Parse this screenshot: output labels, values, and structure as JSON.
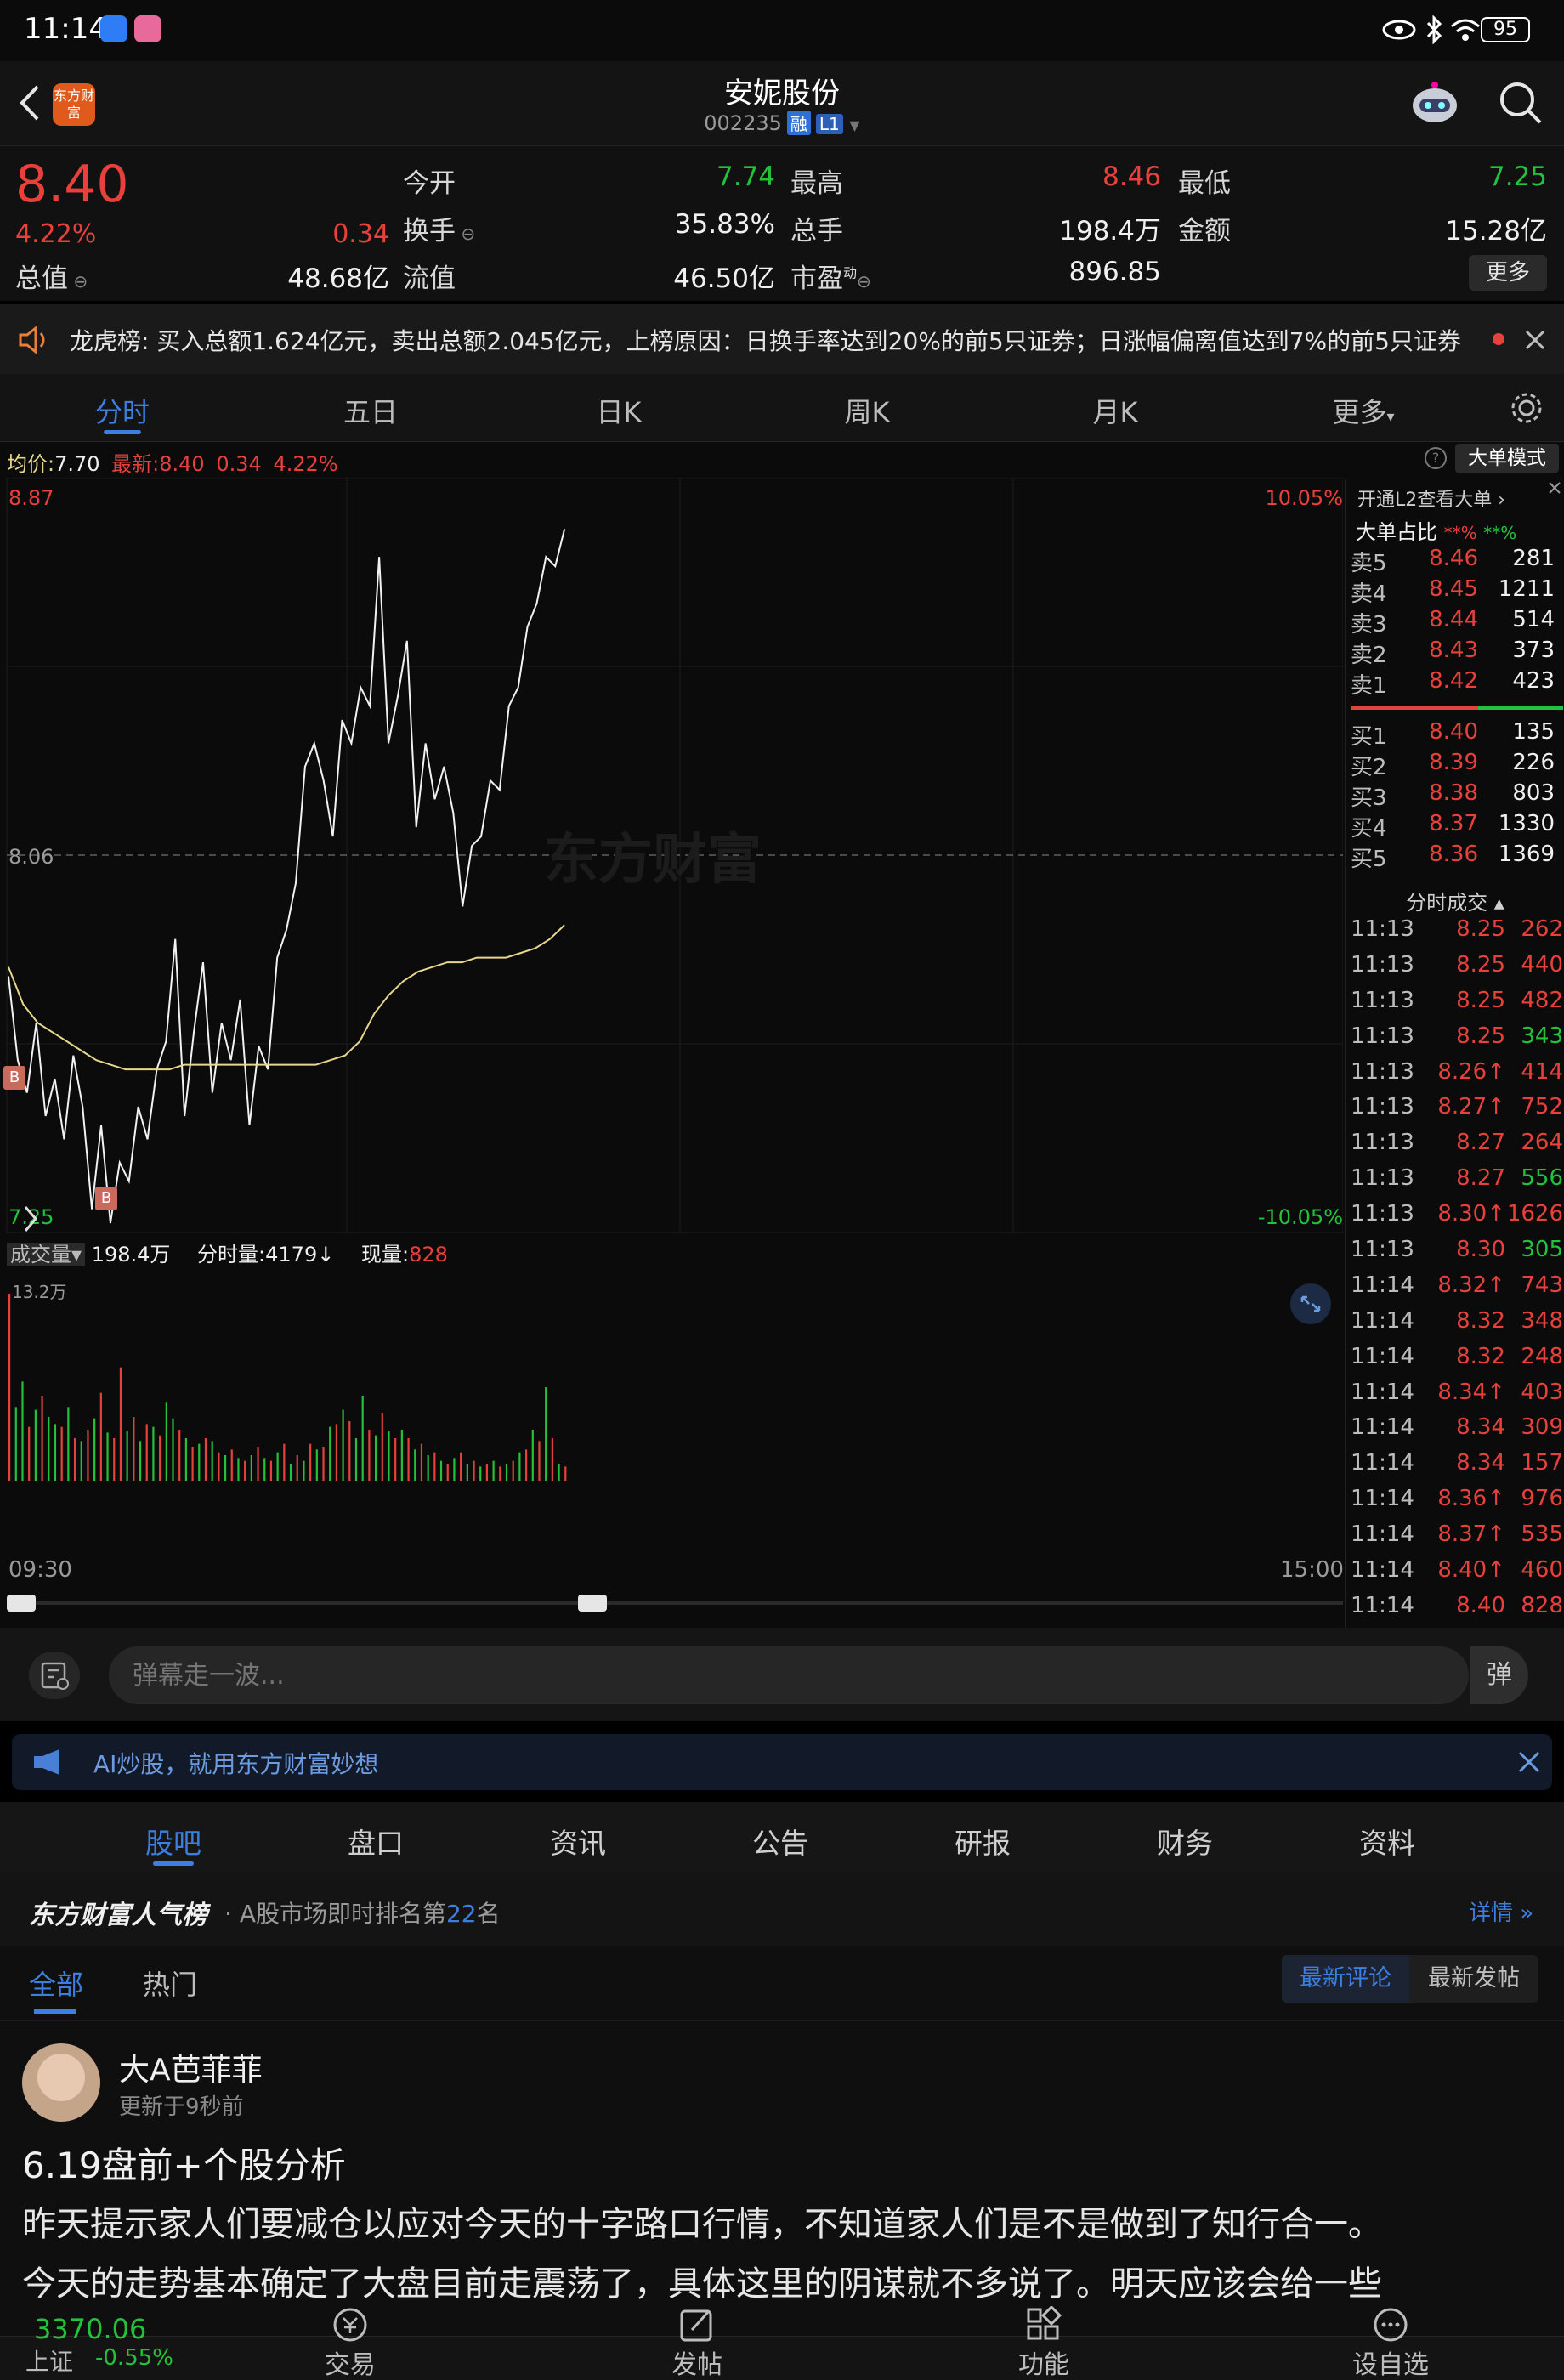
{
  "status_bar": {
    "time": "11:14",
    "battery": "95"
  },
  "header": {
    "logo_text": "东方财富",
    "stock_name": "安妮股份",
    "stock_code": "002235",
    "badge_margin": "融",
    "badge_level": "L1"
  },
  "quote": {
    "price": "8.40",
    "change_pct": "4.22%",
    "change_abs": "0.34",
    "total_value_label": "总值",
    "total_value": "48.68亿",
    "open_label": "今开",
    "open": "7.74",
    "high_label": "最高",
    "high": "8.46",
    "low_label": "最低",
    "low": "7.25",
    "turnover_rate_label": "换手",
    "turnover_rate": "35.83%",
    "volume_label": "总手",
    "volume": "198.4万",
    "amount_label": "金额",
    "amount": "15.28亿",
    "float_label": "流值",
    "float_value": "46.50亿",
    "pe_label": "市盈",
    "pe_sup": "动",
    "pe": "896.85",
    "more_button": "更多"
  },
  "notice": {
    "title": "龙虎榜:",
    "text": "买入总额1.624亿元，卖出总额2.045亿元，上榜原因：日换手率达到20%的前5只证券；日涨幅偏离值达到7%的前5只证券"
  },
  "tabs": [
    "分时",
    "五日",
    "日K",
    "周K",
    "月K",
    "更多"
  ],
  "chart_info": {
    "avg_label": "均价:",
    "avg": "7.70",
    "latest_label": "最新:",
    "latest": "8.40",
    "latest_change": "0.34",
    "latest_pct": "4.22%",
    "big_order_mode": "大单模式",
    "y_top": "8.87",
    "y_mid": "8.06",
    "y_bottom": "7.25",
    "pct_top": "10.05%",
    "pct_bottom": "-10.05%",
    "watermark": "东方财富",
    "vol_label": "成交量",
    "vol_total": "198.4万",
    "vol_minute_label": "分时量:",
    "vol_minute": "4179",
    "vol_now_label": "现量:",
    "vol_now": "828",
    "vol_axis_max": "13.2万",
    "time_start": "09:30",
    "time_end": "15:00"
  },
  "chart_data": {
    "type": "line",
    "title": "",
    "xlabel": "",
    "ylabel": "",
    "ylim": [
      7.25,
      8.87
    ],
    "x_range": [
      "09:30",
      "15:00"
    ],
    "series": [
      {
        "values": [
          7.8,
          7.62,
          7.55,
          7.7,
          7.5,
          7.58,
          7.45,
          7.63,
          7.52,
          7.3,
          7.48,
          7.27,
          7.4,
          7.36,
          7.52,
          7.45,
          7.6,
          7.66,
          7.88,
          7.5,
          7.68,
          7.83,
          7.55,
          7.7,
          7.62,
          7.75,
          7.48,
          7.65,
          7.6,
          7.84,
          7.9,
          8.0,
          8.25,
          8.3,
          8.22,
          8.1,
          8.35,
          8.3,
          8.42,
          8.38,
          8.7,
          8.3,
          8.4,
          8.52,
          8.12,
          8.3,
          8.18,
          8.25,
          8.15,
          7.95,
          8.08,
          8.1,
          8.22,
          8.2,
          8.38,
          8.42,
          8.55,
          8.6,
          8.7,
          8.68,
          8.76
        ]
      },
      {
        "values": [
          7.82,
          7.74,
          7.7,
          7.68,
          7.66,
          7.64,
          7.62,
          7.61,
          7.6,
          7.6,
          7.6,
          7.6,
          7.61,
          7.61,
          7.61,
          7.61,
          7.61,
          7.61,
          7.61,
          7.61,
          7.61,
          7.61,
          7.62,
          7.63,
          7.66,
          7.72,
          7.76,
          7.79,
          7.81,
          7.82,
          7.83,
          7.83,
          7.84,
          7.84,
          7.84,
          7.85,
          7.86,
          7.88,
          7.91
        ]
      }
    ],
    "volume_series": {
      "ylim": [
        0,
        132000
      ],
      "values": [
        132000,
        52000,
        70000,
        38000,
        50000,
        60000,
        45000,
        40000,
        38000,
        52000,
        30000,
        28000,
        36000,
        44000,
        62000,
        34000,
        30000,
        80000,
        35000,
        45000,
        28000,
        40000,
        38000,
        32000,
        55000,
        44000,
        36000,
        30000,
        24000,
        26000,
        30000,
        28000,
        20000,
        18000,
        22000,
        16000,
        14000,
        18000,
        24000,
        16000,
        14000,
        20000,
        26000,
        12000,
        18000,
        14000,
        26000,
        22000,
        24000,
        38000,
        40000,
        50000,
        42000,
        30000,
        60000,
        36000,
        32000,
        48000,
        35000,
        30000,
        36000,
        30000,
        22000,
        26000,
        18000,
        20000,
        14000,
        12000,
        16000,
        20000,
        12000,
        14000,
        10000,
        12000,
        14000,
        10000,
        12000,
        14000,
        20000,
        22000,
        36000,
        28000,
        66000,
        30000,
        12000,
        10000
      ],
      "up": [
        true,
        false,
        false,
        true,
        false,
        true,
        false,
        false,
        true,
        false,
        true,
        false,
        true,
        false,
        true,
        false,
        true,
        true,
        false,
        true,
        false,
        true,
        false,
        true,
        false,
        false,
        true,
        false,
        true,
        false,
        true,
        false,
        true,
        false,
        true,
        false,
        true,
        false,
        true,
        false,
        true,
        false,
        true,
        false,
        true,
        false,
        true,
        false,
        true,
        false,
        true,
        false,
        true,
        false,
        false,
        true,
        false,
        true,
        false,
        true,
        false,
        true,
        false,
        true,
        false,
        true,
        false,
        true,
        false,
        true,
        false,
        true,
        false,
        true,
        false,
        true,
        false,
        true,
        false,
        true,
        false,
        true,
        false,
        true,
        false,
        true
      ]
    }
  },
  "orderbook": {
    "l2_link": "开通L2查看大单",
    "big_ratio_label": "大单占比",
    "sell_ratio": "**%",
    "buy_ratio": "**%",
    "asks": [
      {
        "label": "卖5",
        "price": "8.46",
        "vol": "281"
      },
      {
        "label": "卖4",
        "price": "8.45",
        "vol": "1211"
      },
      {
        "label": "卖3",
        "price": "8.44",
        "vol": "514"
      },
      {
        "label": "卖2",
        "price": "8.43",
        "vol": "373"
      },
      {
        "label": "卖1",
        "price": "8.42",
        "vol": "423"
      }
    ],
    "bids": [
      {
        "label": "买1",
        "price": "8.40",
        "vol": "135"
      },
      {
        "label": "买2",
        "price": "8.39",
        "vol": "226"
      },
      {
        "label": "买3",
        "price": "8.38",
        "vol": "803"
      },
      {
        "label": "买4",
        "price": "8.37",
        "vol": "1330"
      },
      {
        "label": "买5",
        "price": "8.36",
        "vol": "1369"
      }
    ],
    "trades_title": "分时成交",
    "trades": [
      {
        "time": "11:13",
        "price": "8.25",
        "vol": "262",
        "dir": "sell"
      },
      {
        "time": "11:13",
        "price": "8.25",
        "vol": "440",
        "dir": "sell"
      },
      {
        "time": "11:13",
        "price": "8.25",
        "vol": "482",
        "dir": "sell"
      },
      {
        "time": "11:13",
        "price": "8.25",
        "vol": "343",
        "dir": "buy"
      },
      {
        "time": "11:13",
        "price": "8.26↑",
        "vol": "414",
        "dir": "sell"
      },
      {
        "time": "11:13",
        "price": "8.27↑",
        "vol": "752",
        "dir": "sell"
      },
      {
        "time": "11:13",
        "price": "8.27",
        "vol": "264",
        "dir": "sell"
      },
      {
        "time": "11:13",
        "price": "8.27",
        "vol": "556",
        "dir": "buy"
      },
      {
        "time": "11:13",
        "price": "8.30↑",
        "vol": "1626",
        "dir": "sell"
      },
      {
        "time": "11:13",
        "price": "8.30",
        "vol": "305",
        "dir": "buy"
      },
      {
        "time": "11:14",
        "price": "8.32↑",
        "vol": "743",
        "dir": "sell"
      },
      {
        "time": "11:14",
        "price": "8.32",
        "vol": "348",
        "dir": "sell"
      },
      {
        "time": "11:14",
        "price": "8.32",
        "vol": "248",
        "dir": "sell"
      },
      {
        "time": "11:14",
        "price": "8.34↑",
        "vol": "403",
        "dir": "sell"
      },
      {
        "time": "11:14",
        "price": "8.34",
        "vol": "309",
        "dir": "sell"
      },
      {
        "time": "11:14",
        "price": "8.34",
        "vol": "157",
        "dir": "sell"
      },
      {
        "time": "11:14",
        "price": "8.36↑",
        "vol": "976",
        "dir": "sell"
      },
      {
        "time": "11:14",
        "price": "8.37↑",
        "vol": "535",
        "dir": "sell"
      },
      {
        "time": "11:14",
        "price": "8.40↑",
        "vol": "460",
        "dir": "sell"
      },
      {
        "time": "11:14",
        "price": "8.40",
        "vol": "828",
        "dir": "sell"
      }
    ]
  },
  "danmu": {
    "placeholder": "弹幕走一波...",
    "send_label": "弹"
  },
  "ai_bar": {
    "text": "AI炒股，就用东方财富妙想"
  },
  "subtabs": [
    "股吧",
    "盘口",
    "资讯",
    "公告",
    "研报",
    "财务",
    "资料"
  ],
  "ranking": {
    "brand": "东方财富人气榜",
    "text_prefix": "A股市场即时排名第",
    "rank": "22",
    "text_suffix": "名",
    "detail": "详情"
  },
  "feed_filters": {
    "tabs": [
      "全部",
      "热门"
    ],
    "sort_options": [
      "最新评论",
      "最新发帖"
    ]
  },
  "post": {
    "author": "大A芭菲菲",
    "time": "更新于9秒前",
    "title": "6.19盘前+个股分析",
    "body_1": "昨天提示家人们要减仓以应对今天的十字路口行情，不知道家人们是不是做到了知行合一。",
    "body_2": "今天的走势基本确定了大盘目前走震荡了，具体这里的阴谋就不多说了。明天应该会给一些"
  },
  "bottom_nav": {
    "index_value": "3370.06",
    "index_name": "上证",
    "index_change": "-0.55%",
    "items": [
      "交易",
      "发帖",
      "功能",
      "设自选"
    ]
  },
  "colors": {
    "up": "#e8403b",
    "down": "#22c23a",
    "price_line": "#f2f2f2",
    "avg_line": "#e6d78a",
    "accent": "#3d7fe0"
  }
}
